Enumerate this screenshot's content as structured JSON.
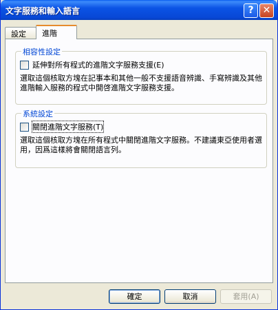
{
  "window": {
    "title": "文字服務和輸入語言",
    "help_glyph": "?",
    "close_glyph": "✕"
  },
  "tabs": [
    {
      "label": "設定"
    },
    {
      "label": "進階"
    }
  ],
  "compatibility": {
    "legend": "相容性設定",
    "checkbox_label": "延伸對所有程式的進階文字服務支援(E)",
    "description": "選取這個核取方塊在記事本和其他一般不支援語音辨識、手寫辨識及其他進階輸入服務的程式中開啓進階文字服務支援。"
  },
  "system": {
    "legend": "系統設定",
    "checkbox_label": "關閉進階文字服務(T)",
    "description": "選取這個核取方塊在所有程式中關閉進階文字服務。不建議東亞使用者選用，因爲這樣將會關閉語言列。"
  },
  "buttons": {
    "ok": "確定",
    "cancel": "取消",
    "apply": "套用(A)"
  }
}
